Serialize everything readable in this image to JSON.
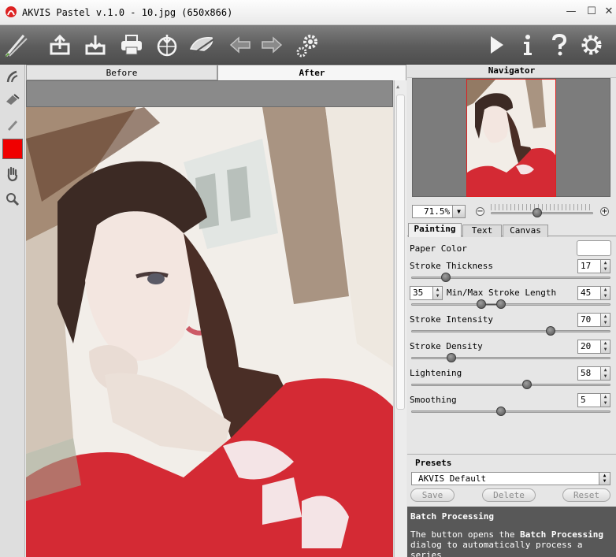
{
  "window": {
    "title": "AKVIS Pastel v.1.0 - 10.jpg (650x866)",
    "minimize_glyph": "—",
    "maximize_glyph": "☐",
    "close_glyph": "✕"
  },
  "toolbar": {
    "left_icons": [
      "brush-logo-icon",
      "open-image-icon",
      "save-image-icon",
      "print-icon",
      "share-icon",
      "load-preset-icon",
      "undo-icon",
      "redo-icon",
      "preferences-icon"
    ],
    "right_icons": [
      "run-icon",
      "info-icon",
      "help-icon",
      "settings-icon"
    ]
  },
  "left_tools": [
    "stroke-direction-icon",
    "eraser-icon",
    "pencil-icon",
    "color-swatch",
    "hand-icon",
    "zoom-icon"
  ],
  "left_tools_color": "#f00000",
  "view_tabs": {
    "before": "Before",
    "after": "After",
    "active": "After"
  },
  "navigator": {
    "title": "Navigator",
    "zoom_value": "71.5%",
    "zoom_minus": "−",
    "zoom_plus": "+",
    "zoom_level_fraction": 0.45
  },
  "settings_tabs": [
    {
      "label": "Painting",
      "active": true
    },
    {
      "label": "Text",
      "active": false
    },
    {
      "label": "Canvas",
      "active": false
    }
  ],
  "painting": {
    "paper_color_label": "Paper Color",
    "paper_color": "#ffffff",
    "stroke_thickness": {
      "label": "Stroke Thickness",
      "value": "17",
      "fraction": 0.17
    },
    "stroke_length": {
      "label": "Min/Max Stroke Length",
      "min": "35",
      "max": "45",
      "min_fraction": 0.35,
      "max_fraction": 0.45
    },
    "stroke_intensity": {
      "label": "Stroke Intensity",
      "value": "70",
      "fraction": 0.7
    },
    "stroke_density": {
      "label": "Stroke Density",
      "value": "20",
      "fraction": 0.2
    },
    "lightening": {
      "label": "Lightening",
      "value": "58",
      "fraction": 0.58
    },
    "smoothing": {
      "label": "Smoothing",
      "value": "5",
      "fraction": 0.45
    }
  },
  "presets": {
    "title": "Presets",
    "selected": "AKVIS Default",
    "save": "Save",
    "delete": "Delete",
    "reset": "Reset"
  },
  "batch": {
    "title": "Batch Processing",
    "desc_prefix": "The button opens the ",
    "desc_bold": "Batch Processing",
    "desc_suffix": "dialog to automatically process a series"
  },
  "colors": {
    "toolbar_bg": "#5c5c5c",
    "batch_bg": "#585858",
    "nav_frame": "#e02020"
  }
}
